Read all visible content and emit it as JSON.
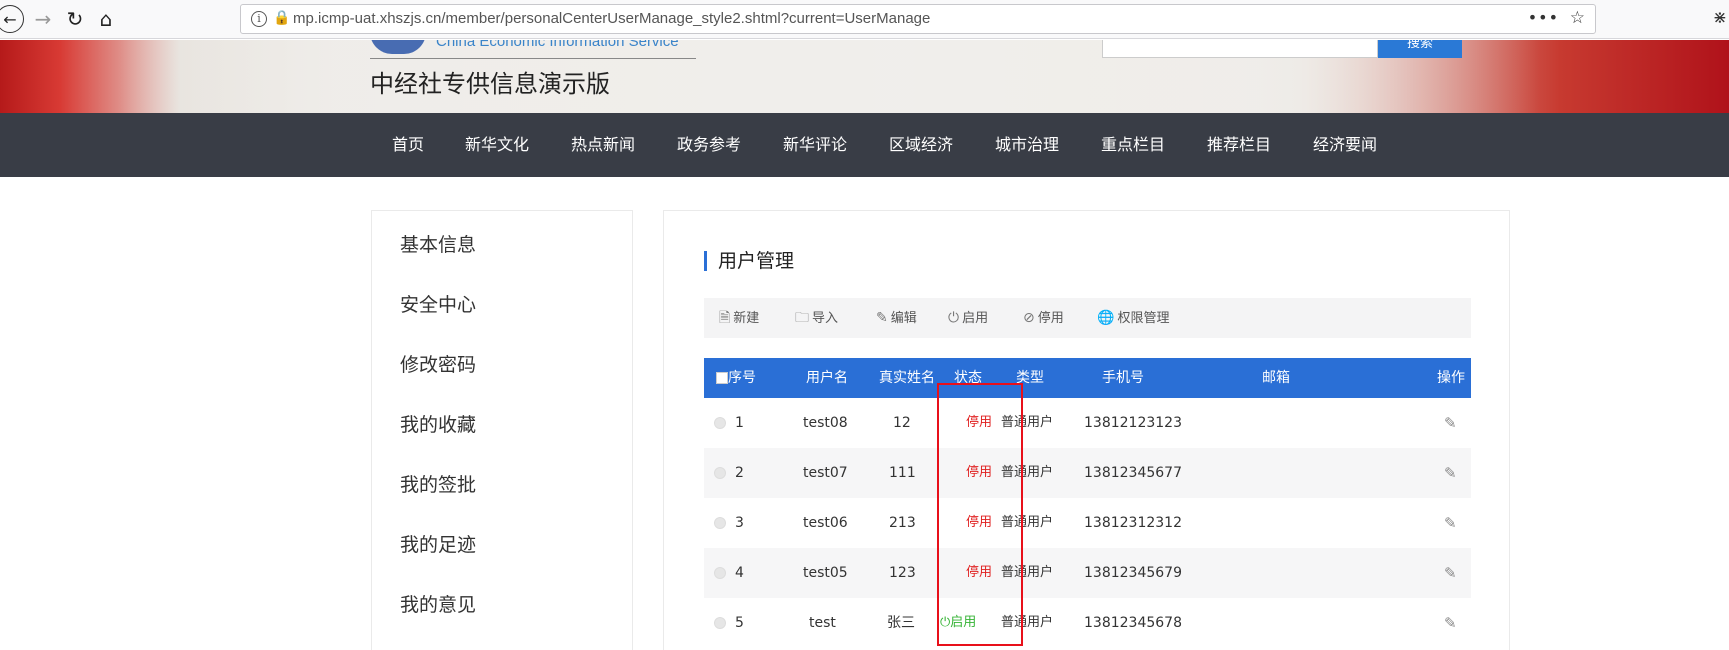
{
  "browser": {
    "url": "mp.icmp-uat.xhszjs.cn/member/personalCenterUserManage_style2.shtml?current=UserManage",
    "icons": [
      "back-icon",
      "forward-icon",
      "reload-icon",
      "home-icon",
      "info-icon",
      "insecure-lock-icon",
      "more-icon",
      "bookmark-star-icon"
    ]
  },
  "header": {
    "logo_en": "China Economic Information Service",
    "site_title": "中经社专供信息演示版",
    "search_button": "搜索"
  },
  "nav": {
    "items": [
      "首页",
      "新华文化",
      "热点新闻",
      "政务参考",
      "新华评论",
      "区域经济",
      "城市治理",
      "重点栏目",
      "推荐栏目",
      "经济要闻"
    ]
  },
  "sidebar": {
    "items": [
      "基本信息",
      "安全中心",
      "修改密码",
      "我的收藏",
      "我的签批",
      "我的足迹",
      "我的意见"
    ]
  },
  "panel": {
    "title": "用户管理",
    "toolbar": [
      {
        "label": "新建",
        "icon": "new-file-icon"
      },
      {
        "label": "导入",
        "icon": "import-icon"
      },
      {
        "label": "编辑",
        "icon": "edit-icon"
      },
      {
        "label": "启用",
        "icon": "power-icon"
      },
      {
        "label": "停用",
        "icon": "disable-icon"
      },
      {
        "label": "权限管理",
        "icon": "globe-icon"
      }
    ]
  },
  "table": {
    "headers": [
      "序号",
      "用户名",
      "真实姓名",
      "状态",
      "类型",
      "手机号",
      "邮箱",
      "操作"
    ],
    "rows": [
      {
        "index": "1",
        "username": "test08",
        "realname": "12",
        "status": "停用",
        "type": "普通用户",
        "phone": "13812123123",
        "email": ""
      },
      {
        "index": "2",
        "username": "test07",
        "realname": "111",
        "status": "停用",
        "type": "普通用户",
        "phone": "13812345677",
        "email": ""
      },
      {
        "index": "3",
        "username": "test06",
        "realname": "213",
        "status": "停用",
        "type": "普通用户",
        "phone": "13812312312",
        "email": ""
      },
      {
        "index": "4",
        "username": "test05",
        "realname": "123",
        "status": "停用",
        "type": "普通用户",
        "phone": "13812345679",
        "email": ""
      },
      {
        "index": "5",
        "username": "test",
        "realname": "张三",
        "status": "启用",
        "type": "普通用户",
        "phone": "13812345678",
        "email": ""
      }
    ]
  },
  "colors": {
    "nav_bg": "#393d46",
    "accent_blue": "#2a6fd6",
    "status_off": "#e02020",
    "status_on": "#35b335",
    "highlight_box": "#e8101a"
  }
}
